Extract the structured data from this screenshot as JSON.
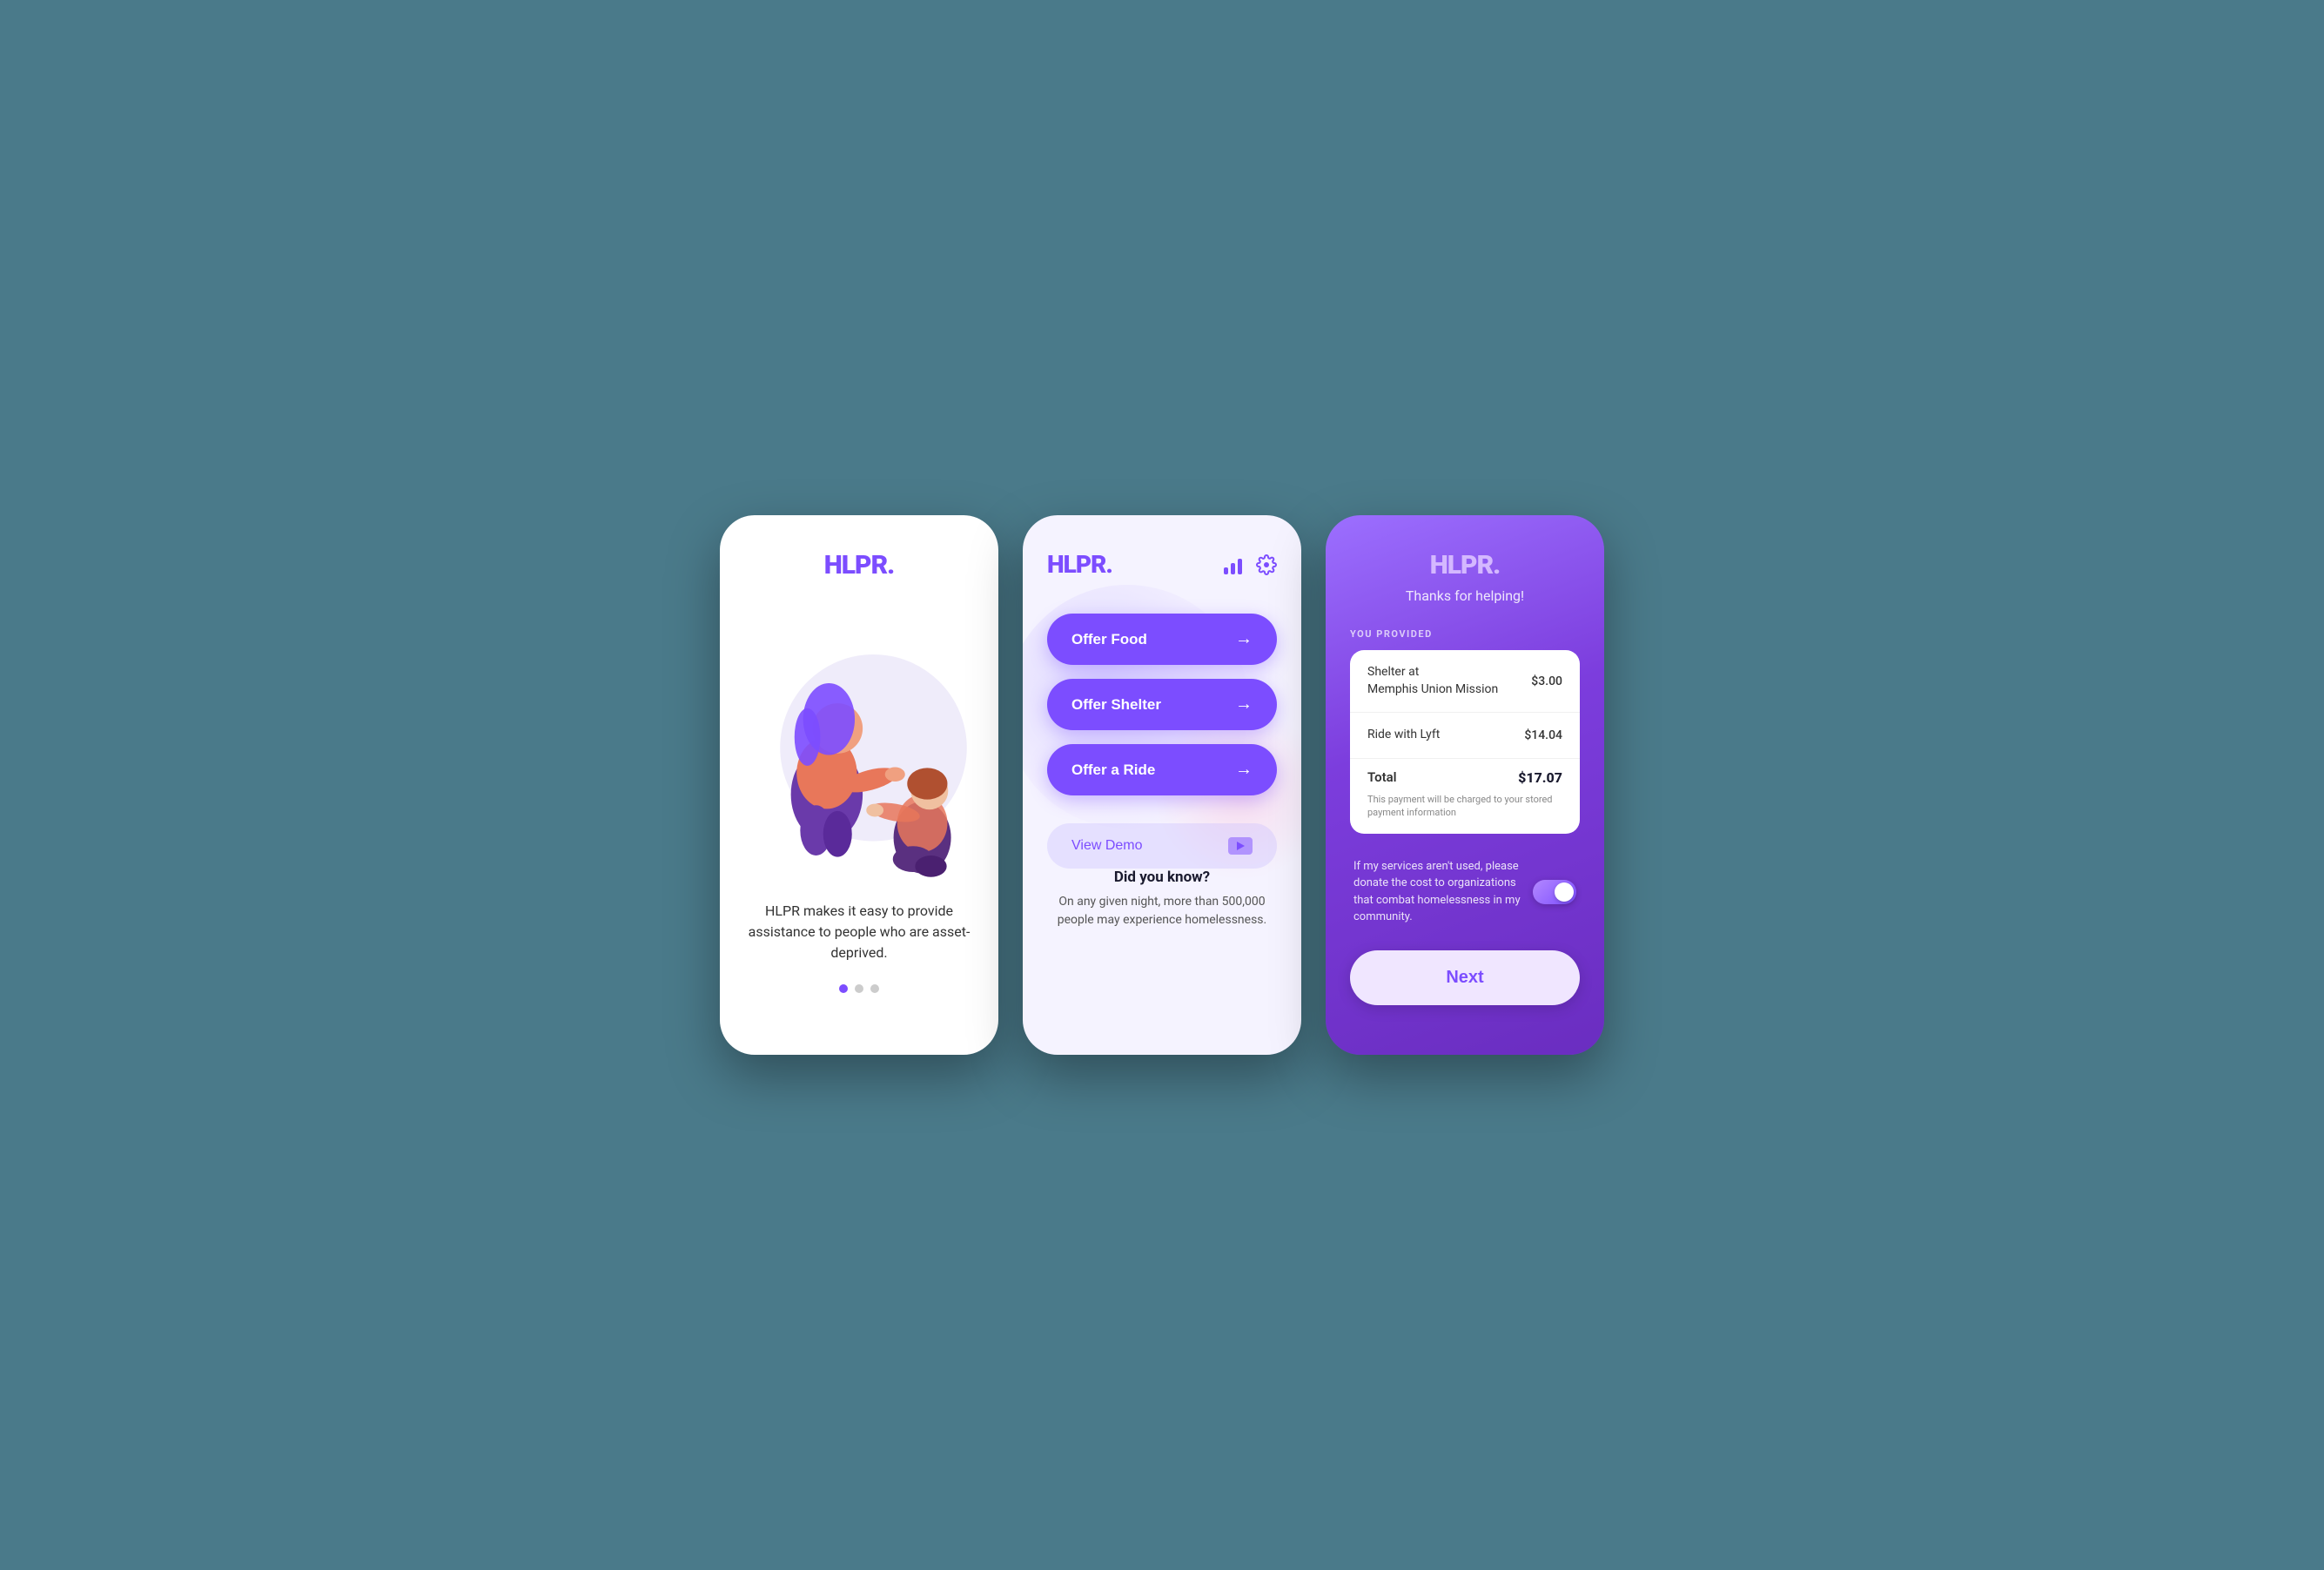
{
  "phone1": {
    "logo": "HLPR",
    "logo_dot": ".",
    "tagline": "HLPR makes it easy to provide assistance to people who are asset-deprived.",
    "dots": [
      {
        "active": true
      },
      {
        "active": false
      },
      {
        "active": false
      }
    ]
  },
  "phone2": {
    "logo": "HLPR",
    "logo_dot": ".",
    "buttons": [
      {
        "label": "Offer Food",
        "arrow": "→"
      },
      {
        "label": "Offer Shelter",
        "arrow": "→"
      },
      {
        "label": "Offer a Ride",
        "arrow": "→"
      }
    ],
    "view_demo_label": "View Demo",
    "fact_title": "Did you know?",
    "fact_text": "On any given night, more than 500,000 people may experience homelessness."
  },
  "phone3": {
    "logo": "HLPR",
    "logo_dot": ".",
    "subtitle": "Thanks for helping!",
    "you_provided_label": "YOU PROVIDED",
    "receipt_items": [
      {
        "name": "Shelter at\nMemphis Union Mission",
        "price": "$3.00"
      },
      {
        "name": "Ride with Lyft",
        "price": "$14.04"
      }
    ],
    "total_label": "Total",
    "total_amount": "$17.07",
    "receipt_note": "This payment will be charged to your stored payment information",
    "toggle_text": "If my services aren't used, please donate the cost to organizations that combat homelessness in my community.",
    "next_label": "Next"
  }
}
